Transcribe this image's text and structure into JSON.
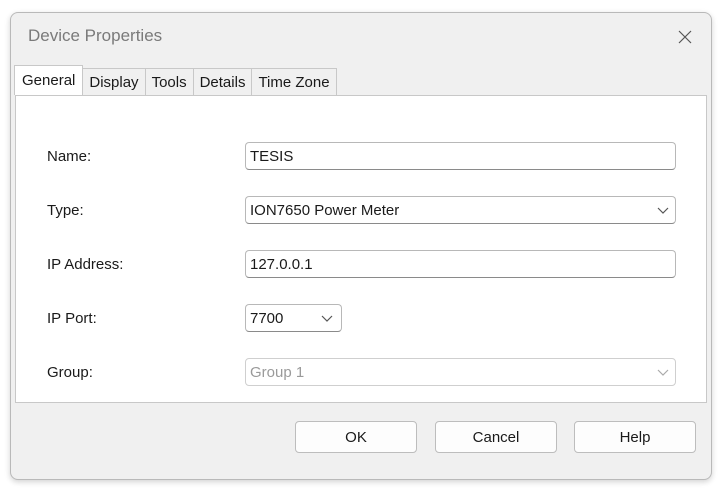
{
  "window": {
    "title": "Device Properties"
  },
  "tabs": [
    {
      "label": "General",
      "active": true
    },
    {
      "label": "Display",
      "active": false
    },
    {
      "label": "Tools",
      "active": false
    },
    {
      "label": "Details",
      "active": false
    },
    {
      "label": "Time Zone",
      "active": false
    }
  ],
  "form": {
    "name": {
      "label": "Name:",
      "value": "TESIS"
    },
    "type": {
      "label": "Type:",
      "value": "ION7650 Power Meter"
    },
    "ip_address": {
      "label": "IP Address:",
      "value": "127.0.0.1"
    },
    "ip_port": {
      "label": "IP Port:",
      "value": "7700"
    },
    "group": {
      "label": "Group:",
      "value": "Group 1",
      "enabled": false
    }
  },
  "buttons": {
    "ok": "OK",
    "cancel": "Cancel",
    "help": "Help"
  },
  "icons": {
    "close": "close-icon",
    "dropdown": "chevron-down-icon"
  }
}
